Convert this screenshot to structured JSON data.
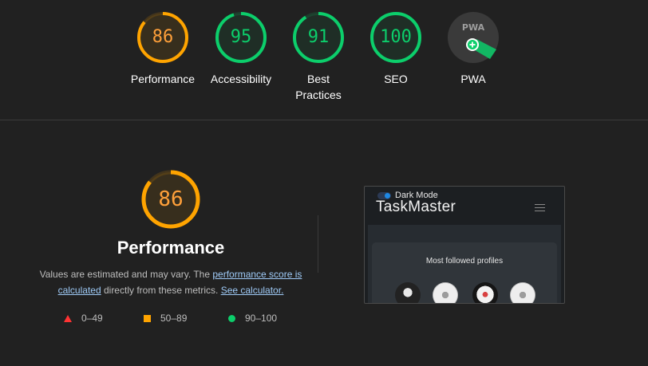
{
  "colors": {
    "background": "#212121",
    "pass": "#0cce6b",
    "average": "#ffa400",
    "fail": "#ff3333",
    "link": "#9fcbf8"
  },
  "categories": [
    {
      "score": "86",
      "label": "Performance",
      "fraction": 0.86,
      "status": "average"
    },
    {
      "score": "95",
      "label": "Accessibility",
      "fraction": 0.95,
      "status": "pass"
    },
    {
      "score": "91",
      "label": "Best Practices",
      "fraction": 0.91,
      "status": "pass"
    },
    {
      "score": "100",
      "label": "SEO",
      "fraction": 1.0,
      "status": "pass"
    },
    {
      "score": "",
      "label": "PWA",
      "icon": "pwa-badge-icon",
      "badge_text": "PWA",
      "status": "pwa"
    }
  ],
  "performance": {
    "score": "86",
    "fraction": 0.86,
    "title": "Performance",
    "desc_prefix": "Values are estimated and may vary. The ",
    "link_score": "performance score is calculated",
    "desc_middle": " directly from these metrics. ",
    "link_calculator": "See calculator."
  },
  "legend": [
    {
      "range": "0–49",
      "icon": "triangle"
    },
    {
      "range": "50–89",
      "icon": "square"
    },
    {
      "range": "90–100",
      "icon": "circle"
    }
  ],
  "screenshot": {
    "toggle_label": "Dark Mode",
    "brand": "TaskMaster",
    "section_title": "Most followed profiles"
  }
}
